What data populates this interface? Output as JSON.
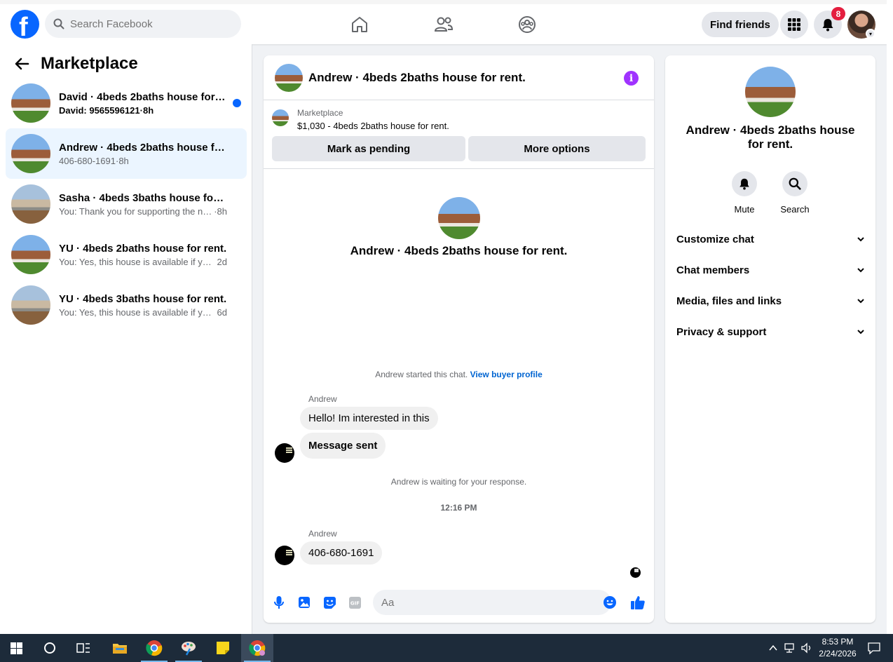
{
  "topbar": {
    "logo_letter": "f",
    "search_placeholder": "Search Facebook",
    "find_friends_label": "Find friends",
    "notification_count": "8"
  },
  "sidebar": {
    "title": "Marketplace",
    "conversations": [
      {
        "name": "David · 4beds 2baths house for r...",
        "preview": "David: 9565596121",
        "time": "8h",
        "unread": true
      },
      {
        "name": "Andrew · 4beds 2baths house for r...",
        "preview": "406-680-1691",
        "time": "8h",
        "active": true
      },
      {
        "name": "Sasha · 4beds 3baths house for rent.",
        "preview": "You: Thank you for supporting the nu...",
        "time": "8h"
      },
      {
        "name": "YU · 4beds 2baths house for rent.",
        "preview": "You: Yes, this house is available if you ...",
        "time": "2d"
      },
      {
        "name": "YU · 4beds 3baths house for rent.",
        "preview": "You: Yes, this house is available if you ...",
        "time": "6d"
      }
    ]
  },
  "chat": {
    "title": "Andrew · 4beds 2baths house for rent.",
    "listing": {
      "label": "Marketplace",
      "price_line": "$1,030 - 4beds 2baths house for rent.",
      "mark_pending_label": "Mark as pending",
      "more_options_label": "More options"
    },
    "intro_title": "Andrew · 4beds 2baths house for rent.",
    "started_text": "Andrew started this chat.",
    "view_profile_link": "View buyer profile",
    "messages_group1": {
      "sender": "Andrew",
      "msg1": "Hello! Im interested in this",
      "msg2": "Message sent"
    },
    "waiting_text": "Andrew is waiting for your response.",
    "timestamp": "12:16 PM",
    "messages_group2": {
      "sender": "Andrew",
      "msg1": "406-680-1691"
    },
    "composer_placeholder": "Aa"
  },
  "details": {
    "title": "Andrew · 4beds 2baths house for rent.",
    "mute_label": "Mute",
    "search_label": "Search",
    "sections": [
      "Customize chat",
      "Chat members",
      "Media, files and links",
      "Privacy & support"
    ]
  },
  "taskbar": {
    "time": "8:53 PM",
    "date": "2/24/2026"
  },
  "colors": {
    "brand_blue": "#0866ff",
    "info_purple": "#a033ff",
    "badge_red": "#e41e3f",
    "active_row": "#ebf5ff"
  }
}
